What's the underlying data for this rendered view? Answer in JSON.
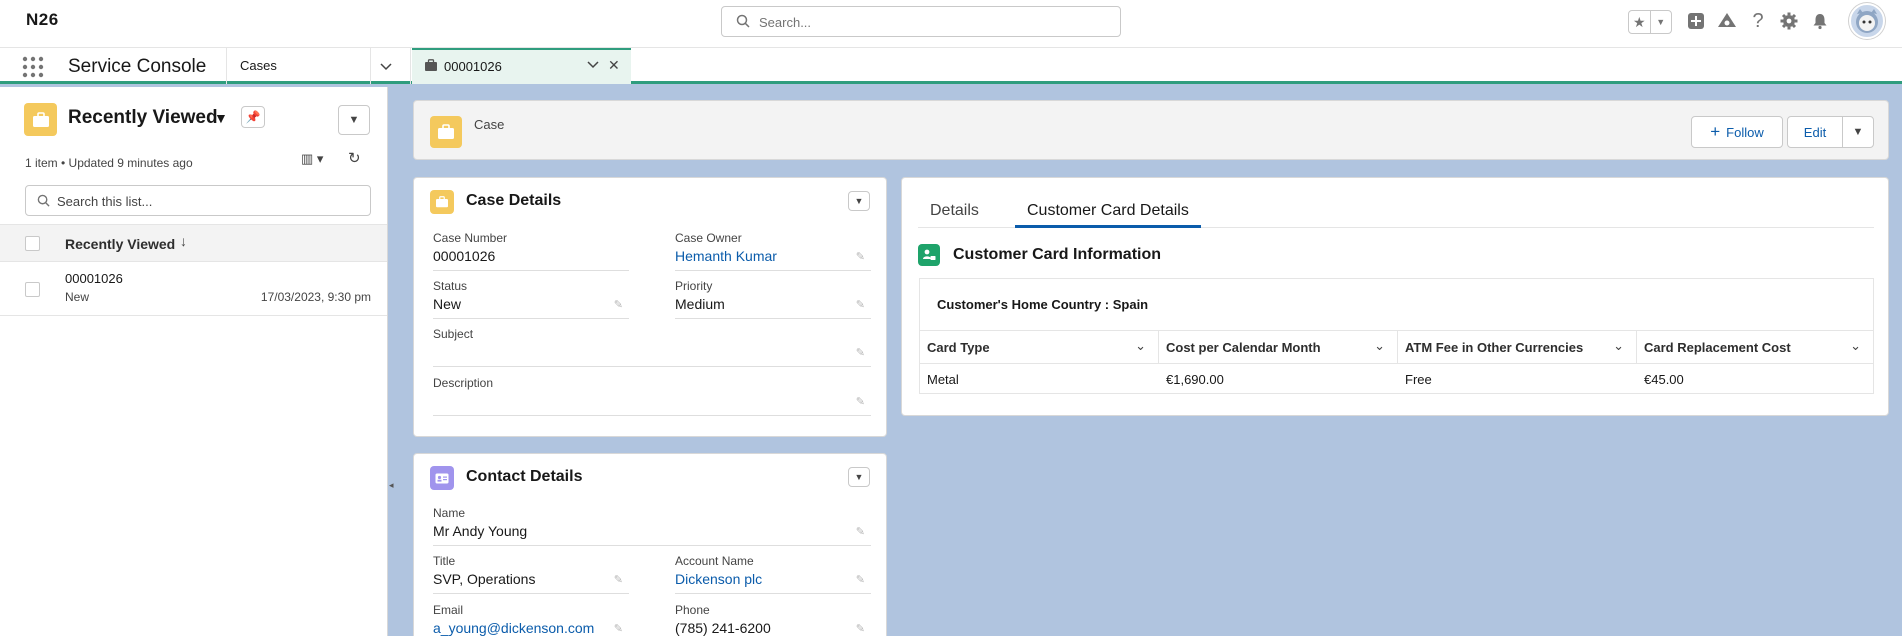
{
  "header": {
    "logo": "N26",
    "search_placeholder": "Search...",
    "icons": [
      "star-icon",
      "chevron-down-icon",
      "add-icon",
      "trailhead-icon",
      "help-icon",
      "setup-gear-icon",
      "notification-bell-icon",
      "avatar"
    ]
  },
  "nav": {
    "app_name": "Service Console",
    "object_tab": "Cases",
    "record_tab": "00001026"
  },
  "list": {
    "title": "Recently Viewed",
    "meta": "1 item • Updated 9 minutes ago",
    "search_placeholder": "Search this list...",
    "column_header": "Recently Viewed",
    "rows": [
      {
        "number": "00001026",
        "status": "New",
        "date": "17/03/2023, 9:30 pm"
      }
    ]
  },
  "record": {
    "object_label": "Case",
    "follow_label": "Follow",
    "edit_label": "Edit"
  },
  "case_details": {
    "title": "Case Details",
    "fields": {
      "case_number_label": "Case Number",
      "case_number": "00001026",
      "case_owner_label": "Case Owner",
      "case_owner": "Hemanth Kumar",
      "status_label": "Status",
      "status": "New",
      "priority_label": "Priority",
      "priority": "Medium",
      "subject_label": "Subject",
      "subject": "",
      "description_label": "Description",
      "description": ""
    }
  },
  "contact_details": {
    "title": "Contact Details",
    "fields": {
      "name_label": "Name",
      "name": "Mr Andy Young",
      "title_label": "Title",
      "title": "SVP, Operations",
      "account_label": "Account Name",
      "account": "Dickenson plc",
      "email_label": "Email",
      "email": "a_young@dickenson.com",
      "phone_label": "Phone",
      "phone": "(785) 241-6200"
    }
  },
  "right_panel": {
    "tabs": [
      "Details",
      "Customer Card Details"
    ],
    "active_tab": "Customer Card Details",
    "section_title": "Customer Card Information",
    "home_country": "Customer's Home Country : Spain",
    "columns": [
      "Card Type",
      "Cost per Calendar Month",
      "ATM Fee in Other Currencies",
      "Card Replacement Cost"
    ],
    "rows": [
      [
        "Metal",
        "€1,690.00",
        "Free",
        "€45.00"
      ]
    ]
  },
  "colors": {
    "accent": "#0b5cab",
    "nav_underline": "#2f9d7e",
    "case_icon": "#f4c95d",
    "contact_icon": "#a094ed",
    "card_icon": "#1ea36a",
    "background": "#b0c4df"
  }
}
